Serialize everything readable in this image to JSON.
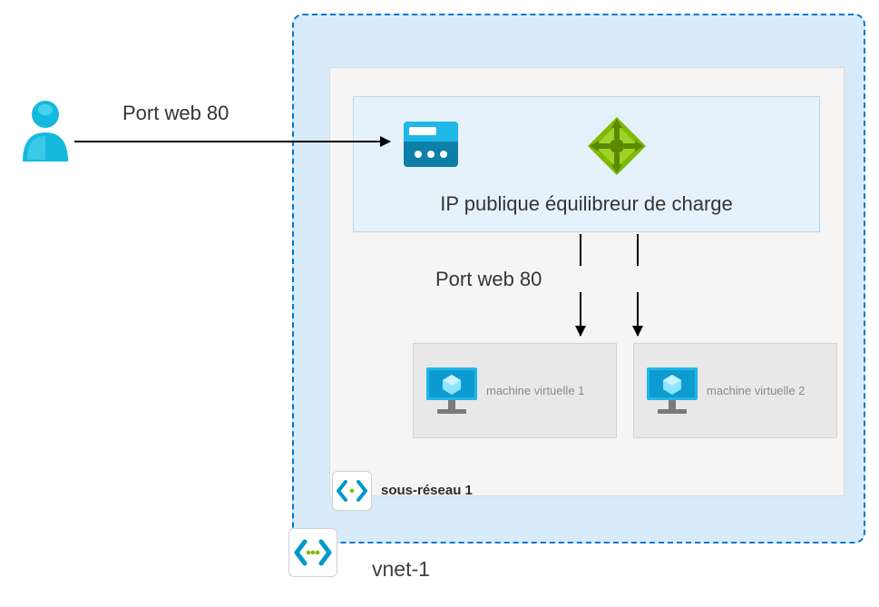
{
  "labels": {
    "port_web_user": "Port web 80",
    "port_web_backend": "Port web 80",
    "lb_box_caption": "IP publique équilibreur de charge",
    "subnet": "sous-réseau 1",
    "vnet": "vnet-1",
    "vm1": "machine virtuelle 1",
    "vm2": "machine virtuelle 2"
  },
  "colors": {
    "azure_blue": "#0099cc",
    "vnet_border": "#0078d4",
    "vnet_fill": "#d7ebfa",
    "lb_green": "#7fba00",
    "lb_dark": "#5a8a00"
  }
}
